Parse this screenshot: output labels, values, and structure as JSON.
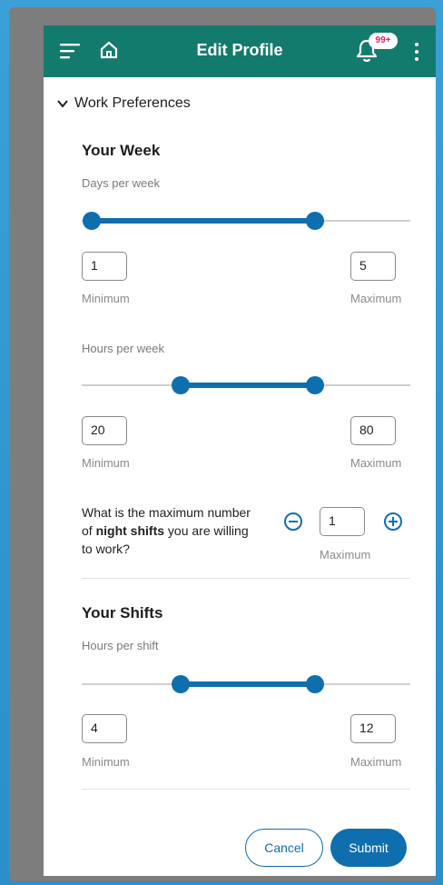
{
  "header": {
    "title": "Edit Profile",
    "badge": "99+"
  },
  "section": {
    "label": "Work Preferences"
  },
  "your_week": {
    "heading": "Your Week",
    "days": {
      "label": "Days per week",
      "min_value": "1",
      "max_value": "5",
      "range_low_fraction": 0.03,
      "range_high_fraction": 0.71,
      "min_caption": "Minimum",
      "max_caption": "Maximum"
    },
    "hours": {
      "label": "Hours per week",
      "min_value": "20",
      "max_value": "80",
      "range_low_fraction": 0.3,
      "range_high_fraction": 0.71,
      "min_caption": "Minimum",
      "max_caption": "Maximum"
    },
    "night_shifts": {
      "question_prefix": "What is the maximum number of ",
      "question_bold": "night shifts",
      "question_suffix": " you are willing to work?",
      "value": "1",
      "caption": "Maximum"
    }
  },
  "your_shifts": {
    "heading": "Your Shifts",
    "hours_per_shift": {
      "label": "Hours per shift",
      "min_value": "4",
      "max_value": "12",
      "range_low_fraction": 0.3,
      "range_high_fraction": 0.71,
      "min_caption": "Minimum",
      "max_caption": "Maximum"
    }
  },
  "actions": {
    "cancel_label": "Cancel",
    "submit_label": "Submit"
  },
  "colors": {
    "header": "#137a6e",
    "accent": "#0f6fae",
    "badge_text": "#d6266f"
  },
  "icons": {
    "menu": "menu-icon",
    "home": "home-icon",
    "bell": "bell-icon",
    "more": "more-vertical-icon",
    "chevron": "chevron-down-icon",
    "minus": "minus-circle-icon",
    "plus": "plus-circle-icon"
  }
}
